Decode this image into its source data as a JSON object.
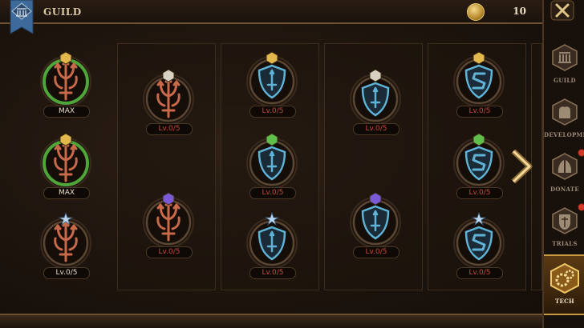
{
  "header": {
    "title": "GUILD",
    "coins": "10",
    "close_label": ""
  },
  "sidebar": {
    "items": [
      {
        "label": "GUILD",
        "icon": "guild-icon",
        "badge": false
      },
      {
        "label": "DEVELOPMENT",
        "icon": "development-icon",
        "badge": false
      },
      {
        "label": "DONATE",
        "icon": "donate-icon",
        "badge": true
      },
      {
        "label": "TRIALS",
        "icon": "trials-icon",
        "badge": true
      },
      {
        "label": "TECH",
        "icon": "tech-icon",
        "badge": false,
        "active": true
      }
    ]
  },
  "tech_tree": {
    "left_column": [
      {
        "level": "MAX",
        "icon": "trident-icon",
        "gem": "gold",
        "ring": "green"
      },
      {
        "level": "MAX",
        "icon": "trident-icon",
        "gem": "gold",
        "ring": "green"
      },
      {
        "level": "Lv.0/5",
        "icon": "trident-icon",
        "gem": "star",
        "ring": "dark"
      }
    ],
    "columns": [
      {
        "nodes": [
          {
            "level": "Lv.0/5",
            "icon": "trident-icon",
            "gem": "white"
          },
          {
            "level": "Lv.0/5",
            "icon": "trident-icon",
            "gem": "purple"
          }
        ]
      },
      {
        "nodes": [
          {
            "level": "Lv.0/5",
            "icon": "sword-shield-icon",
            "gem": "gold"
          },
          {
            "level": "Lv.0/5",
            "icon": "sword-shield-icon",
            "gem": "green"
          },
          {
            "level": "Lv.0/5",
            "icon": "sword-shield-icon",
            "gem": "star"
          }
        ]
      },
      {
        "nodes": [
          {
            "level": "Lv.0/5",
            "icon": "sword-shield-icon",
            "gem": "white"
          },
          {
            "level": "Lv.0/5",
            "icon": "sword-shield-icon",
            "gem": "purple"
          }
        ]
      },
      {
        "nodes": [
          {
            "level": "Lv.0/5",
            "icon": "s-shield-icon",
            "gem": "gold"
          },
          {
            "level": "Lv.0/5",
            "icon": "s-shield-icon",
            "gem": "green"
          },
          {
            "level": "Lv.0/5",
            "icon": "s-shield-icon",
            "gem": "star"
          }
        ]
      }
    ]
  },
  "colors": {
    "accent": "#d8b36a",
    "level_text": "#c74a3a",
    "ring_green": "#4fa53a",
    "shield_blue": "#5fb3d6",
    "trident_orange": "#c86a4a"
  }
}
